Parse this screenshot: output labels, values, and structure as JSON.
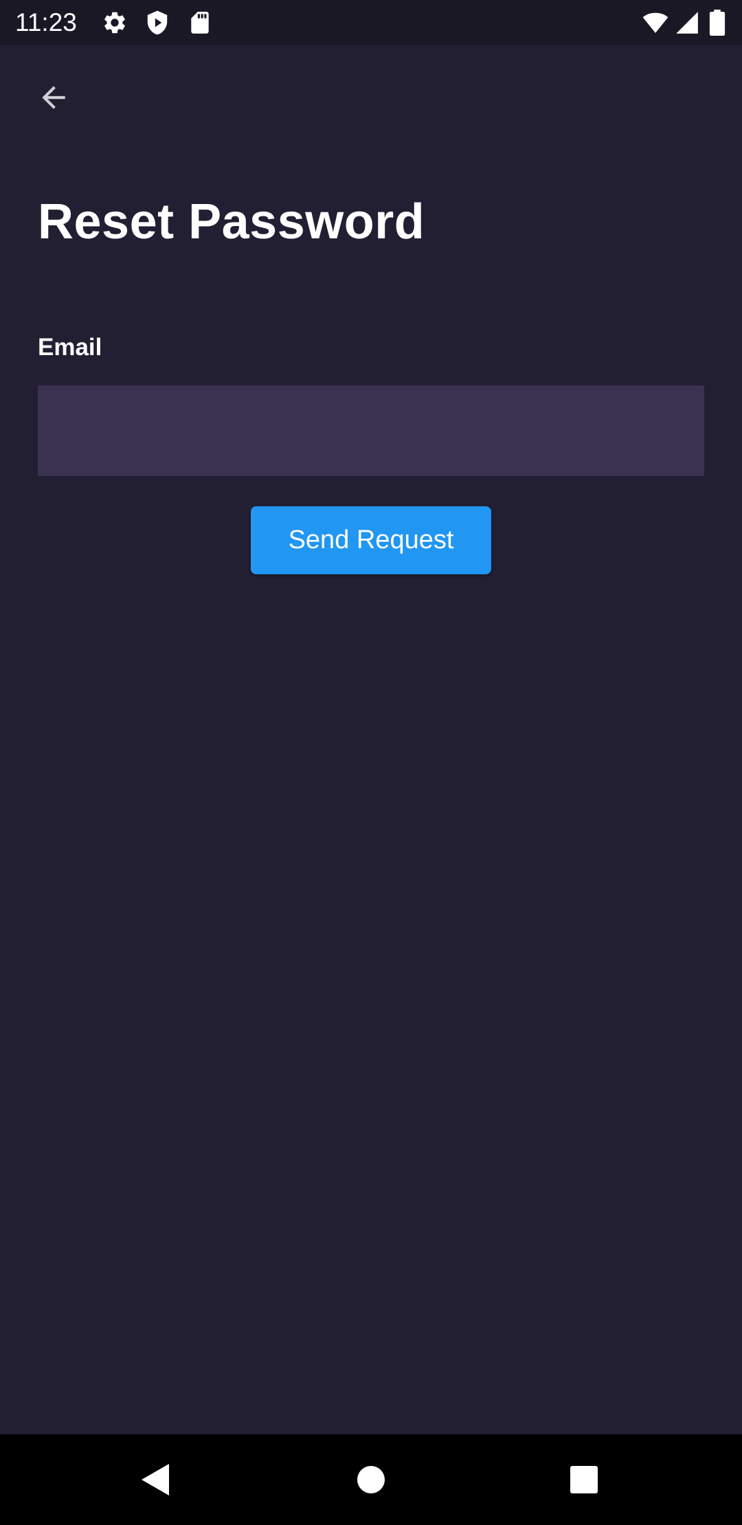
{
  "status_bar": {
    "time": "11:23",
    "icons": [
      "gear-icon",
      "shield-icon",
      "sd-card-icon",
      "wifi-icon",
      "signal-icon",
      "battery-icon"
    ]
  },
  "header": {
    "back_icon": "arrow-left-icon"
  },
  "main": {
    "title": "Reset Password",
    "email_label": "Email",
    "email_value": "",
    "email_placeholder": "",
    "send_button_label": "Send Request"
  },
  "nav_bar": {
    "icons": [
      "back-triangle-icon",
      "home-circle-icon",
      "recents-square-icon"
    ]
  },
  "colors": {
    "background": "#231F33",
    "status_bar": "#1B1826",
    "input_background": "#3A3250",
    "accent": "#2196F3",
    "nav_bar": "#000000"
  }
}
